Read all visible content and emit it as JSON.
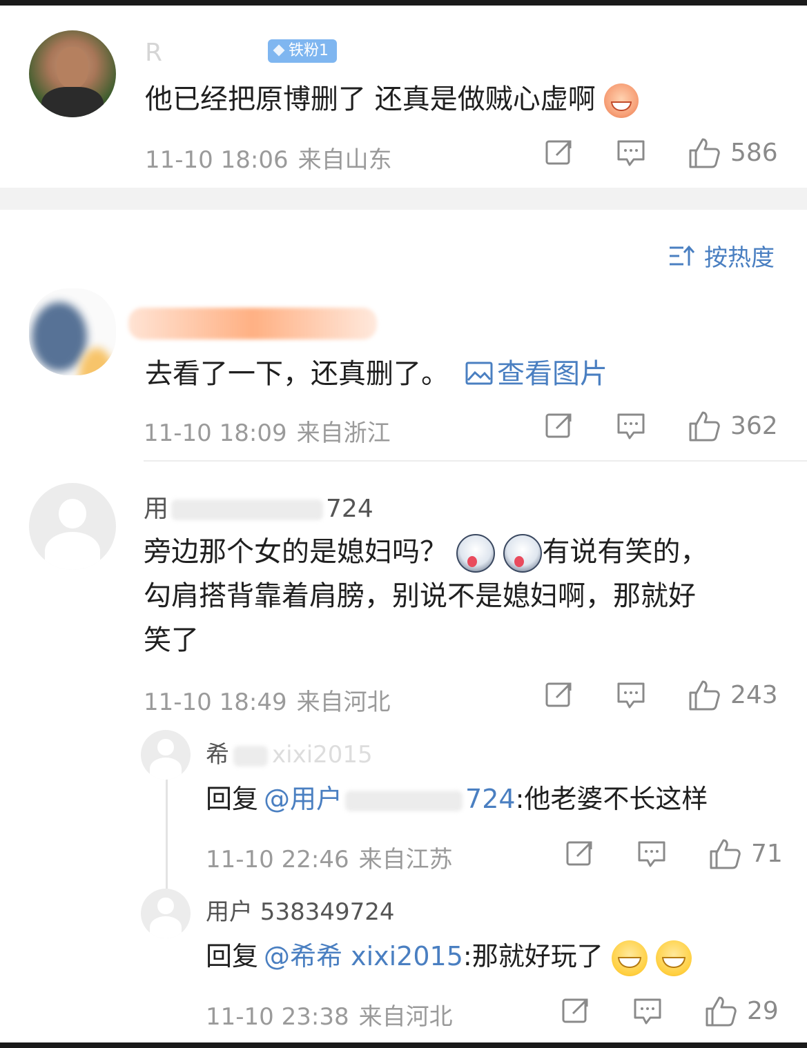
{
  "comments": [
    {
      "username": "R",
      "badge": "铁粉1",
      "text": "他已经把原博删了 还真是做贼心虚啊",
      "time": "11-10 18:06",
      "location": "来自山东",
      "likes": "586",
      "emoji": "laugh-emoji"
    },
    {
      "username": "",
      "text": "去看了一下，还真删了。",
      "link": "查看图片",
      "time": "11-10 18:09",
      "location": "来自浙江",
      "likes": "362"
    },
    {
      "username_start": "用",
      "username_end": "724",
      "text_line1": "旁边那个女的是媳妇吗？",
      "text_line1_tail": "有说有笑的，",
      "text_line2": "勾肩搭背靠着肩膀，别说不是媳妇啊，那就好",
      "text_line3": "笑了",
      "time": "11-10 18:49",
      "location": "来自河北",
      "likes": "243",
      "replies": [
        {
          "username_start": "希",
          "username_end": "xixi2015",
          "reply_prefix": "回复",
          "mention_start": "@用户",
          "mention_end": "724",
          "text": ":他老婆不长这样",
          "time": "11-10 22:46",
          "location": "来自江苏",
          "likes": "71"
        },
        {
          "username": "用户 538349724",
          "reply_prefix": "回复",
          "mention": "@希希 xixi2015",
          "text": ":那就好玩了",
          "time": "11-10 23:38",
          "location": "来自河北",
          "likes": "29"
        }
      ]
    }
  ],
  "sort": {
    "label": "按热度"
  },
  "colors": {
    "link": "#4a7fc1",
    "meta": "#9a9a9a",
    "badge": "#7fb6f0"
  }
}
